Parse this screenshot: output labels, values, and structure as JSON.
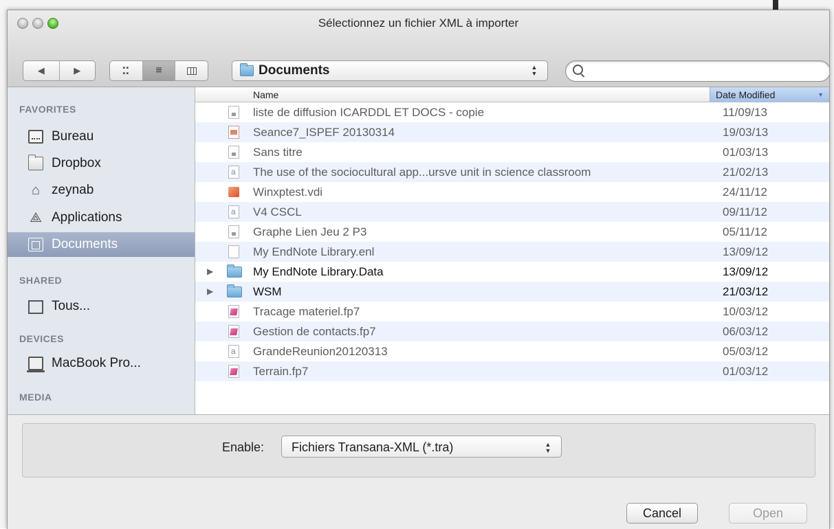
{
  "window": {
    "title": "Sélectionnez un fichier  XML à importer"
  },
  "toolbar": {
    "location": "Documents",
    "search_placeholder": "",
    "view_modes": [
      "icon-view",
      "list-view",
      "column-view"
    ],
    "active_view": "list-view"
  },
  "sidebar": {
    "sections": [
      {
        "title": "FAVORITES",
        "items": [
          {
            "label": "Bureau",
            "icon": "desktop-icon"
          },
          {
            "label": "Dropbox",
            "icon": "folder-icon"
          },
          {
            "label": "zeynab",
            "icon": "home-icon"
          },
          {
            "label": "Applications",
            "icon": "applications-icon"
          },
          {
            "label": "Documents",
            "icon": "documents-icon",
            "selected": true
          }
        ]
      },
      {
        "title": "SHARED",
        "items": [
          {
            "label": "Tous...",
            "icon": "network-icon"
          }
        ]
      },
      {
        "title": "DEVICES",
        "items": [
          {
            "label": "MacBook Pro...",
            "icon": "laptop-icon"
          }
        ]
      },
      {
        "title": "MEDIA",
        "items": []
      }
    ]
  },
  "list": {
    "columns": {
      "name": "Name",
      "date": "Date Modified"
    },
    "rows": [
      {
        "name": "liste de diffusion ICARDDL ET DOCS - copie",
        "date": "11/09/13",
        "icon": "document-icon",
        "dir": false
      },
      {
        "name": "Seance7_ISPEF 20130314",
        "date": "19/03/13",
        "icon": "presentation-icon",
        "dir": false
      },
      {
        "name": "Sans titre",
        "date": "01/03/13",
        "icon": "document-icon",
        "dir": false
      },
      {
        "name": "The use of the sociocultural app...ursve unit in science classroom",
        "date": "21/02/13",
        "icon": "text-document-icon",
        "dir": false
      },
      {
        "name": "Winxptest.vdi",
        "date": "24/11/12",
        "icon": "virtualbox-disk-icon",
        "dir": false
      },
      {
        "name": "V4 CSCL",
        "date": "09/11/12",
        "icon": "text-document-icon",
        "dir": false
      },
      {
        "name": "Graphe Lien Jeu 2 P3",
        "date": "05/11/12",
        "icon": "document-icon",
        "dir": false
      },
      {
        "name": "My EndNote Library.enl",
        "date": "13/09/12",
        "icon": "blank-document-icon",
        "dir": false
      },
      {
        "name": "My EndNote Library.Data",
        "date": "13/09/12",
        "icon": "folder-icon",
        "dir": true
      },
      {
        "name": "WSM",
        "date": "21/03/12",
        "icon": "folder-icon",
        "dir": true
      },
      {
        "name": "Tracage materiel.fp7",
        "date": "10/03/12",
        "icon": "filemaker-icon",
        "dir": false
      },
      {
        "name": "Gestion de contacts.fp7",
        "date": "06/03/12",
        "icon": "filemaker-icon",
        "dir": false
      },
      {
        "name": "GrandeReunion20120313",
        "date": "05/03/12",
        "icon": "text-document-icon",
        "dir": false
      },
      {
        "name": "Terrain.fp7",
        "date": "01/03/12",
        "icon": "filemaker-icon",
        "dir": false
      }
    ]
  },
  "footer": {
    "enable_label": "Enable:",
    "enable_value": "Fichiers Transana-XML (*.tra)",
    "cancel_label": "Cancel",
    "open_label": "Open"
  }
}
